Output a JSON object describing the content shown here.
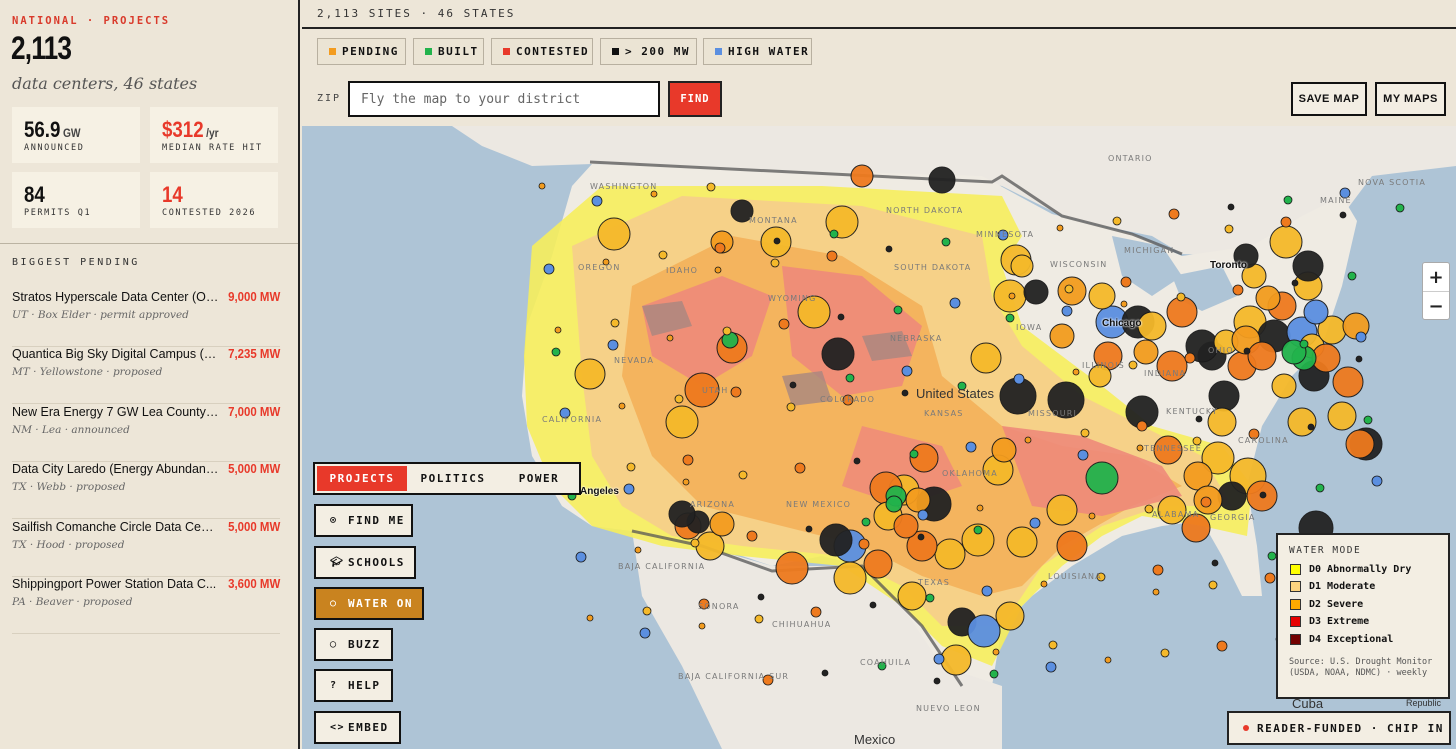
{
  "sidebar": {
    "kicker": "NATIONAL · PROJECTS",
    "total": "2,113",
    "subline": "data centers, 46 states",
    "stats": [
      {
        "value": "56.9",
        "unit": "GW",
        "label": "ANNOUNCED"
      },
      {
        "value": "$312",
        "unit": "/yr",
        "label": "MEDIAN RATE HIT"
      },
      {
        "value": "84",
        "unit": "",
        "label": "PERMITS Q1"
      },
      {
        "value": "14",
        "unit": "",
        "label": "CONTESTED 2026"
      }
    ],
    "biggest_heading": "BIGGEST PENDING",
    "pending": [
      {
        "name": "Stratos Hyperscale Data Center (O'L...",
        "mw": "9,000 MW",
        "meta": "UT · Box Elder · permit approved"
      },
      {
        "name": "Quantica Big Sky Digital Campus (Br...",
        "mw": "7,235 MW",
        "meta": "MT · Yellowstone · proposed"
      },
      {
        "name": "New Era Energy 7 GW Lea County AI ...",
        "mw": "7,000 MW",
        "meta": "NM · Lea · announced"
      },
      {
        "name": "Data City Laredo (Energy Abundance)",
        "mw": "5,000 MW",
        "meta": "TX · Webb · proposed"
      },
      {
        "name": "Sailfish Comanche Circle Data Cent...",
        "mw": "5,000 MW",
        "meta": "TX · Hood · proposed"
      },
      {
        "name": "Shippingport Power Station Data C...",
        "mw": "3,600 MW",
        "meta": "PA · Beaver · proposed"
      }
    ]
  },
  "topbar": {
    "sites": "2,113 SITES · 46 STATES"
  },
  "filters": [
    {
      "label": "PENDING",
      "color": "#f39c1f"
    },
    {
      "label": "BUILT",
      "color": "#22b34c"
    },
    {
      "label": "CONTESTED",
      "color": "#e8392a"
    },
    {
      "label": "> 200 MW",
      "color": "#111111"
    },
    {
      "label": "HIGH WATER",
      "color": "#5b8fe0"
    }
  ],
  "search": {
    "zip_label": "ZIP",
    "placeholder": "Fly the map to your district",
    "find_label": "FIND"
  },
  "actions": {
    "save_map": "SAVE MAP",
    "my_maps": "MY MAPS"
  },
  "zoom": {
    "in": "+",
    "out": "−"
  },
  "mode_tabs": [
    "PROJECTS",
    "POLITICS",
    "POWER"
  ],
  "tools": [
    {
      "label": "FIND ME",
      "icon": "target-icon"
    },
    {
      "label": "SCHOOLS",
      "icon": "graduation-cap-icon"
    },
    {
      "label": "WATER ON",
      "icon": "water-drop-icon"
    },
    {
      "label": "BUZZ",
      "icon": "chat-bubble-icon"
    },
    {
      "label": "HELP",
      "icon": "question-icon"
    },
    {
      "label": "EMBED",
      "icon": "code-icon"
    }
  ],
  "legend": {
    "title": "WATER MODE",
    "items": [
      {
        "label": "D0 Abnormally Dry",
        "color": "#ffff00"
      },
      {
        "label": "D1 Moderate",
        "color": "#fcd37f"
      },
      {
        "label": "D2 Severe",
        "color": "#ffaa00"
      },
      {
        "label": "D3 Extreme",
        "color": "#e60000"
      },
      {
        "label": "D4 Exceptional",
        "color": "#730000"
      }
    ],
    "source": "Source: U.S. Drought Monitor (USDA, NOAA, NDMC) · weekly"
  },
  "chip_in": "READER-FUNDED · CHIP IN",
  "map_labels": {
    "states": [
      "WASHINGTON",
      "OREGON",
      "CALIFORNIA",
      "NEVADA",
      "IDAHO",
      "MONTANA",
      "WYOMING",
      "UTAH",
      "ARIZONA",
      "COLORADO",
      "NEW MEXICO",
      "NORTH DAKOTA",
      "SOUTH DAKOTA",
      "NEBRASKA",
      "KANSAS",
      "OKLAHOMA",
      "TEXAS",
      "MINNESOTA",
      "IOWA",
      "MISSOURI",
      "WISCONSIN",
      "MICHIGAN",
      "ILLINOIS",
      "INDIANA",
      "OHIO",
      "KENTUCKY",
      "TENNESSEE",
      "LOUISIANA",
      "GEORGIA",
      "ALABAMA",
      "CAROLINA",
      "MAINE",
      "NOVA SCOTIA",
      "ONTARIO",
      "SONORA",
      "CHIHUAHUA",
      "COAHUILA",
      "NUEVO LEON",
      "BAJA CALIFORNIA",
      "BAJA CALIFORNIA SUR"
    ],
    "cities": [
      "Chicago",
      "Toronto",
      "Angeles"
    ],
    "countries": [
      "United States",
      "Mexico",
      "Cuba",
      "Republic"
    ]
  }
}
